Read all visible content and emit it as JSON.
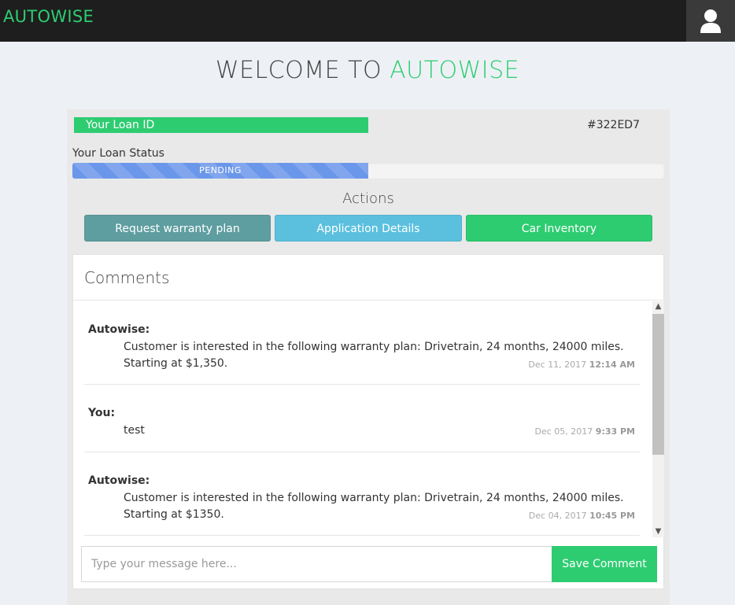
{
  "header": {
    "brand": "AUTOWISE",
    "user_icon": "user-icon"
  },
  "welcome": {
    "prefix": "WELCOME TO ",
    "accent": "AUTOWISE"
  },
  "loan": {
    "id_label": "Your Loan ID",
    "id_value": "#322ED7",
    "status_label": "Your Loan Status",
    "status_text": "PENDING",
    "progress_fraction": 0.5
  },
  "actions": {
    "title": "Actions",
    "warranty_label": "Request warranty plan",
    "details_label": "Application Details",
    "inventory_label": "Car Inventory"
  },
  "comments": {
    "title": "Comments",
    "items": [
      {
        "author": "Autowise:",
        "text": "Customer is interested in the following warranty plan: Drivetrain, 24 months, 24000 miles. Starting at $1,350.",
        "date": "Dec 11, 2017",
        "time": "12:14 AM"
      },
      {
        "author": "You:",
        "text": "test",
        "date": "Dec 05, 2017",
        "time": "9:33 PM"
      },
      {
        "author": "Autowise:",
        "text": "Customer is interested in the following warranty plan: Drivetrain, 24 months, 24000 miles. Starting at $1350.",
        "date": "Dec 04, 2017",
        "time": "10:45 PM"
      }
    ],
    "input_placeholder": "Type your message here...",
    "input_value": "",
    "save_label": "Save Comment"
  },
  "colors": {
    "brand_green": "#2ecc71",
    "progress_blue": "#6b97ea",
    "warranty_btn": "#5f9ea0",
    "details_btn": "#5bc0de",
    "topbar": "#1e1e1e"
  }
}
